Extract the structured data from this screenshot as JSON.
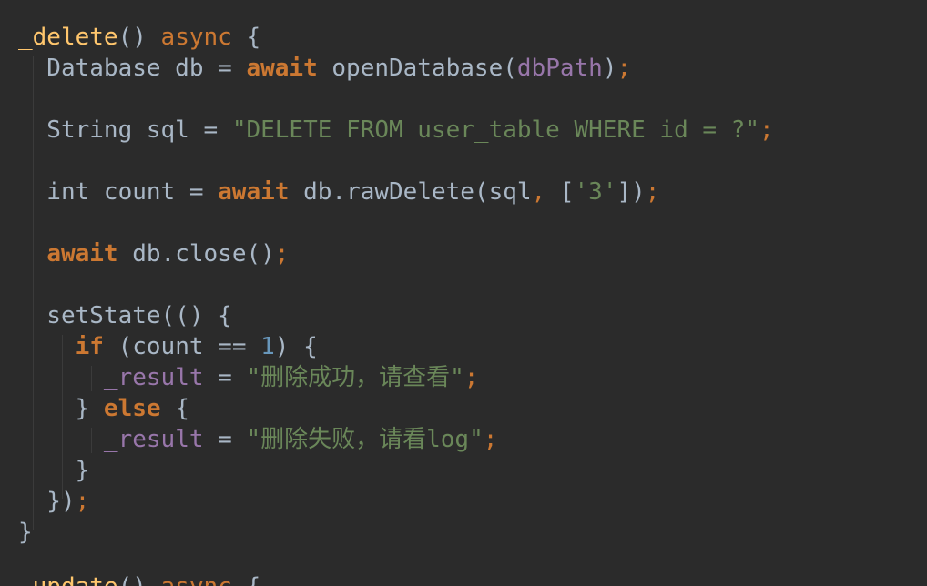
{
  "editor": {
    "lines": [
      [
        {
          "t": "_delete",
          "c": "fn"
        },
        {
          "t": "() ",
          "c": "plain"
        },
        {
          "t": "async",
          "c": "kwn"
        },
        {
          "t": " {",
          "c": "plain"
        }
      ],
      [
        {
          "t": "  Database db = ",
          "c": "plain"
        },
        {
          "t": "await",
          "c": "kw"
        },
        {
          "t": " openDatabase(",
          "c": "plain"
        },
        {
          "t": "dbPath",
          "c": "param"
        },
        {
          "t": ")",
          "c": "plain"
        },
        {
          "t": ";",
          "c": "kwn"
        }
      ],
      [],
      [
        {
          "t": "  String sql = ",
          "c": "plain"
        },
        {
          "t": "\"DELETE FROM user_table WHERE id = ?\"",
          "c": "str"
        },
        {
          "t": ";",
          "c": "kwn"
        }
      ],
      [],
      [
        {
          "t": "  int count = ",
          "c": "plain"
        },
        {
          "t": "await",
          "c": "kw"
        },
        {
          "t": " db.rawDelete(sql",
          "c": "plain"
        },
        {
          "t": ",",
          "c": "kwn"
        },
        {
          "t": " [",
          "c": "plain"
        },
        {
          "t": "'3'",
          "c": "str"
        },
        {
          "t": "])",
          "c": "plain"
        },
        {
          "t": ";",
          "c": "kwn"
        }
      ],
      [],
      [
        {
          "t": "  ",
          "c": "plain"
        },
        {
          "t": "await",
          "c": "kw"
        },
        {
          "t": " db.close()",
          "c": "plain"
        },
        {
          "t": ";",
          "c": "kwn"
        }
      ],
      [],
      [
        {
          "t": "  setState(() {",
          "c": "plain"
        }
      ],
      [
        {
          "t": "    ",
          "c": "plain"
        },
        {
          "t": "if",
          "c": "kw"
        },
        {
          "t": " (count == ",
          "c": "plain"
        },
        {
          "t": "1",
          "c": "num"
        },
        {
          "t": ") {",
          "c": "plain"
        }
      ],
      [
        {
          "t": "      ",
          "c": "plain"
        },
        {
          "t": "_result",
          "c": "field"
        },
        {
          "t": " = ",
          "c": "plain"
        },
        {
          "t": "\"删除成功，请查看\"",
          "c": "str"
        },
        {
          "t": ";",
          "c": "kwn"
        }
      ],
      [
        {
          "t": "    } ",
          "c": "plain"
        },
        {
          "t": "else",
          "c": "kw"
        },
        {
          "t": " {",
          "c": "plain"
        }
      ],
      [
        {
          "t": "      ",
          "c": "plain"
        },
        {
          "t": "_result",
          "c": "field"
        },
        {
          "t": " = ",
          "c": "plain"
        },
        {
          "t": "\"删除失败，请看log\"",
          "c": "str"
        },
        {
          "t": ";",
          "c": "kwn"
        }
      ],
      [
        {
          "t": "    }",
          "c": "plain"
        }
      ],
      [
        {
          "t": "  })",
          "c": "plain"
        },
        {
          "t": ";",
          "c": "kwn"
        }
      ],
      [
        {
          "t": "}",
          "c": "plain"
        }
      ]
    ],
    "partial_line": [
      {
        "t": "_update",
        "c": "fn"
      },
      {
        "t": "() ",
        "c": "plain"
      },
      {
        "t": "async",
        "c": "kwn"
      },
      {
        "t": " {",
        "c": "plain"
      }
    ]
  }
}
